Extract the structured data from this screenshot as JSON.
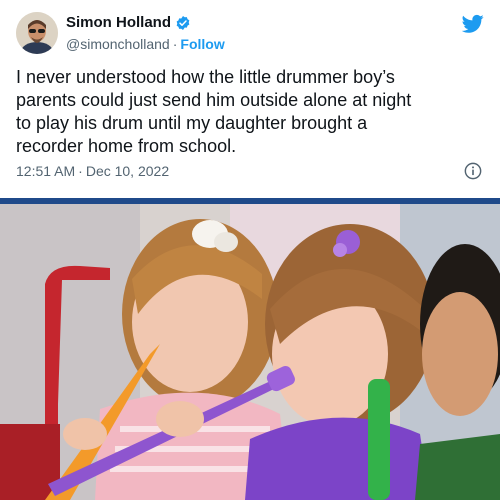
{
  "tweet": {
    "display_name": "Simon Holland",
    "handle": "@simoncholland",
    "separator": "·",
    "follow_label": "Follow",
    "text": "I never understood how the little drummer boy’s\nparents could just send him outside alone at night\nto play his drum until my daughter brought a\nrecorder home from school.",
    "time": "12:51 AM",
    "date": "Dec 10, 2022",
    "icons": [
      "avatar",
      "verified-badge-icon",
      "twitter-bird-icon",
      "info-icon"
    ],
    "colors": {
      "accent": "#1d9bf0",
      "text": "#0f1419",
      "muted": "#536471",
      "divider": "#1f4a8a"
    }
  },
  "photo": {
    "subject": "children playing recorders"
  }
}
